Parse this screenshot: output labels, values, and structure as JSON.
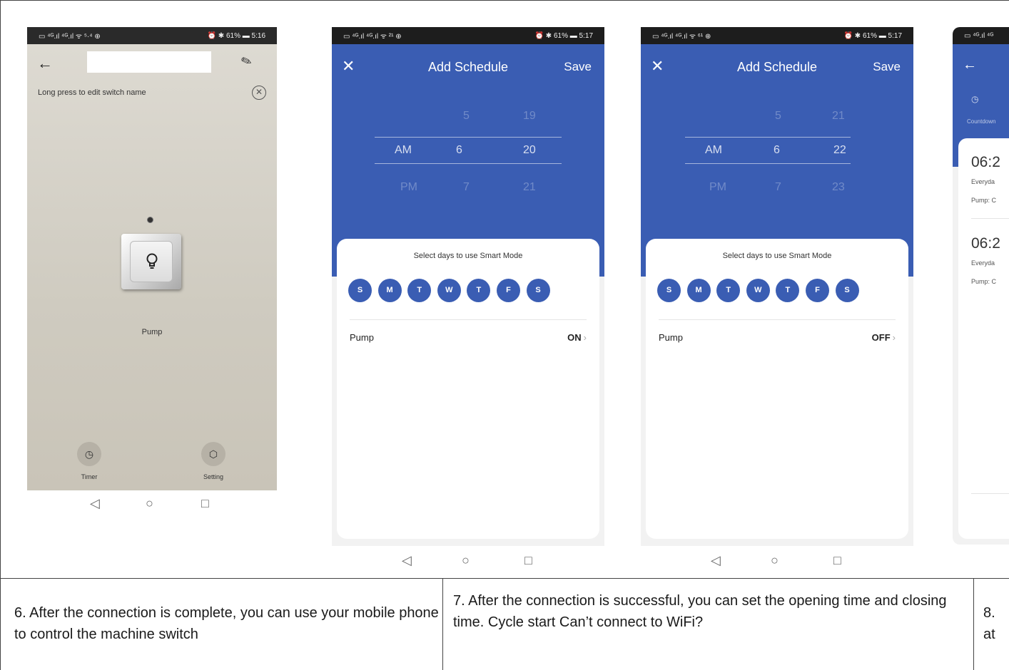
{
  "phone1": {
    "status_left": "▭ ⁴ᴳ.ıl ⁴ᴳ.ıl ᯤ ⁵·⁴ ⊕",
    "status_right": "⏰ ✱ 61% ▬ 5:16",
    "hint": "Long press to edit switch name",
    "device_name": "Pump",
    "timer_label": "Timer",
    "setting_label": "Setting"
  },
  "schedule_on": {
    "status_left": "▭ ⁴ᴳ.ıl ⁴ᴳ.ıl ᯤ ²¹ ⊕",
    "status_right": "⏰ ✱ 61% ▬ 5:17",
    "close": "✕",
    "title": "Add Schedule",
    "save": "Save",
    "hours": [
      "5",
      "6",
      "7"
    ],
    "minutes": [
      "19",
      "20",
      "21"
    ],
    "ampm": [
      "AM",
      "PM"
    ],
    "card_hint": "Select days to use Smart Mode",
    "days": [
      "S",
      "M",
      "T",
      "W",
      "T",
      "F",
      "S"
    ],
    "row_label": "Pump",
    "row_value": "ON"
  },
  "schedule_off": {
    "status_left": "▭ ⁴ᴳ.ıl ⁴ᴳ.ıl ᯤ ⁶¹ ⊕",
    "status_right": "⏰ ✱ 61% ▬ 5:17",
    "close": "✕",
    "title": "Add Schedule",
    "save": "Save",
    "hours": [
      "5",
      "6",
      "7"
    ],
    "minutes": [
      "21",
      "22",
      "23"
    ],
    "ampm": [
      "AM",
      "PM"
    ],
    "card_hint": "Select days to use Smart Mode",
    "days": [
      "S",
      "M",
      "T",
      "W",
      "T",
      "F",
      "S"
    ],
    "row_label": "Pump",
    "row_value": "OFF"
  },
  "phone4": {
    "status_left": "▭ ⁴ᴳ.ıl ⁴ᴳ",
    "tab_label": "Countdown",
    "item1_time": "06:2",
    "item1_repeat": "Everyda",
    "item1_action": "Pump: C",
    "item2_time": "06:2",
    "item2_repeat": "Everyda",
    "item2_action": "Pump: C"
  },
  "captions": {
    "c6": "6. After the connection is complete, you can use your mobile phone to control the machine switch",
    "c7": "7. After the connection is successful, you can set the opening time and closing time. Cycle start Can’t connect to WiFi?",
    "c8": "8. at"
  }
}
